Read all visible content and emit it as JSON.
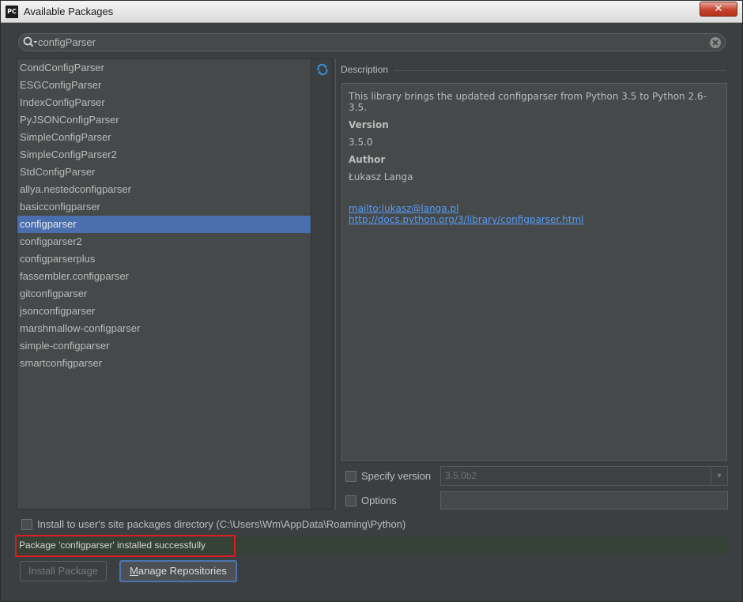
{
  "window": {
    "app_icon": "PC",
    "title": "Available Packages",
    "close_label": "✕"
  },
  "search": {
    "value": "configParser"
  },
  "packages": [
    "CondConfigParser",
    "ESGConfigParser",
    "IndexConfigParser",
    "PyJSONConfigParser",
    "SimpleConfigParser",
    "SimpleConfigParser2",
    "StdConfigParser",
    "allya.nestedconfigparser",
    "basicconfigparser",
    "configparser",
    "configparser2",
    "configparserplus",
    "fassembler.configparser",
    "gitconfigparser",
    "jsonconfigparser",
    "marshmallow-configparser",
    "simple-configparser",
    "smartconfigparser"
  ],
  "selected_package": "configparser",
  "description": {
    "header": "Description",
    "summary": "This library brings the updated configparser from Python 3.5 to Python 2.6-3.5.",
    "version_label": "Version",
    "version_value": "3.5.0",
    "author_label": "Author",
    "author_value": "Łukasz Langa",
    "links": [
      "mailto:lukasz@langa.pl",
      "http://docs.python.org/3/library/configparser.html"
    ]
  },
  "options": {
    "specify_version_label": "Specify version",
    "specify_version_value": "3.5.0b2",
    "options_label": "Options",
    "options_value": "",
    "install_user_label": "Install to user's site packages directory (C:\\Users\\Wm\\AppData\\Roaming\\Python)"
  },
  "status": {
    "message": "Package 'configparser' installed successfully"
  },
  "buttons": {
    "install_label": "Install Package",
    "manage_label_mnemonic": "M",
    "manage_label_rest": "anage Repositories"
  },
  "colors": {
    "selection": "#4b6eaf",
    "link": "#589df6",
    "status_background": "#344134",
    "highlight": "#d81e1e"
  }
}
